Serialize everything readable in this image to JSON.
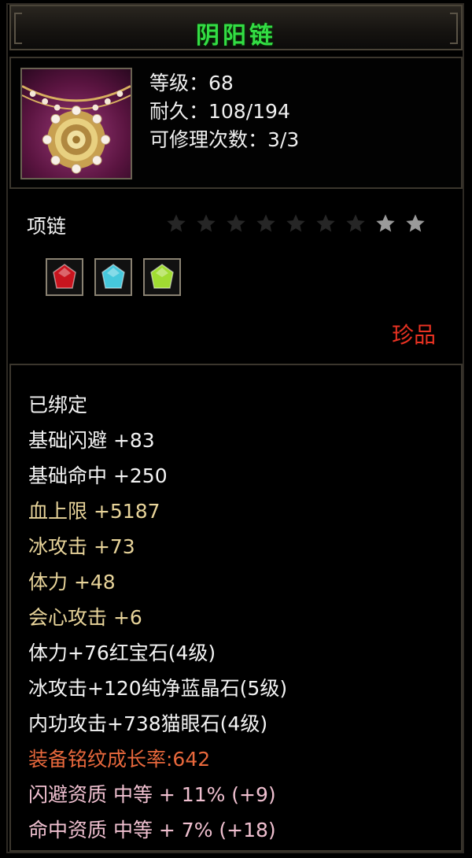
{
  "item": {
    "name": "阴阳链",
    "type": "项链",
    "quality": "珍品",
    "stars_total": 9,
    "stars_lit": 2
  },
  "stats": {
    "level": "等级：68",
    "durability": "耐久：108/194",
    "repairs": "可修理次数：3/3"
  },
  "gems": [
    {
      "name": "red-gem-icon",
      "color": "#c8141e"
    },
    {
      "name": "blue-gem-icon",
      "color": "#46c8dc"
    },
    {
      "name": "cat-eye-gem-icon",
      "color": "#a0dc32"
    }
  ],
  "attributes": [
    {
      "text": "已绑定",
      "color": "white"
    },
    {
      "text": "基础闪避  +83",
      "color": "white"
    },
    {
      "text": "基础命中  +250",
      "color": "white"
    },
    {
      "text": "血上限  +5187",
      "color": "gold"
    },
    {
      "text": "冰攻击  +73",
      "color": "gold"
    },
    {
      "text": "体力  +48",
      "color": "gold"
    },
    {
      "text": "会心攻击  +6",
      "color": "gold"
    },
    {
      "text": "体力+76红宝石(4级)",
      "color": "white"
    },
    {
      "text": "冰攻击+120纯净蓝晶石(5级)",
      "color": "white"
    },
    {
      "text": "内功攻击+738猫眼石(4级)",
      "color": "white"
    },
    {
      "text": "装备铭纹成长率:642",
      "color": "orange"
    },
    {
      "text": "闪避资质  中等  +  11% (+9)",
      "color": "pink"
    },
    {
      "text": "命中资质  中等  +  7% (+18)",
      "color": "pink"
    }
  ],
  "colors": {
    "title": "#33dd44",
    "quality": "#e83222",
    "star_lit": "#9a9a9a",
    "star_dim": "#262626"
  }
}
